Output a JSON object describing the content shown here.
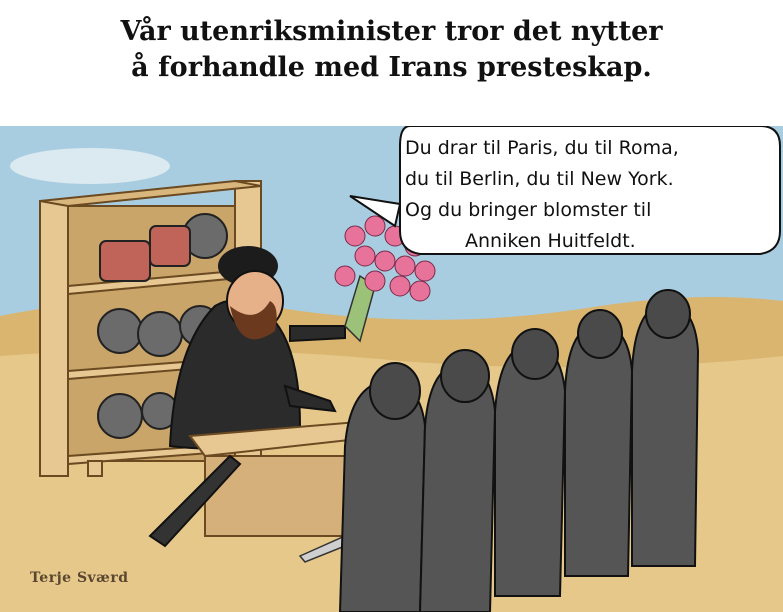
{
  "caption": {
    "line1": "Vår utenriksminister tror det nytter",
    "line2": "å forhandle med Irans presteskap."
  },
  "speech_bubble": {
    "line1": "Du drar til Paris, du til Roma,",
    "line2": "du til Berlin, du til New York.",
    "line3": "Og du bringer blomster til",
    "line4": "Anniken Huitfeldt."
  },
  "signature": "Terje Sværd",
  "colors": {
    "sky": "#a9cde0",
    "sand": "#e6c98a",
    "dune": "#d9b56f",
    "shelf_wood": "#e8c892",
    "robe": "#2b2b2b",
    "hood": "#555555",
    "flowers": "#e8739a"
  }
}
